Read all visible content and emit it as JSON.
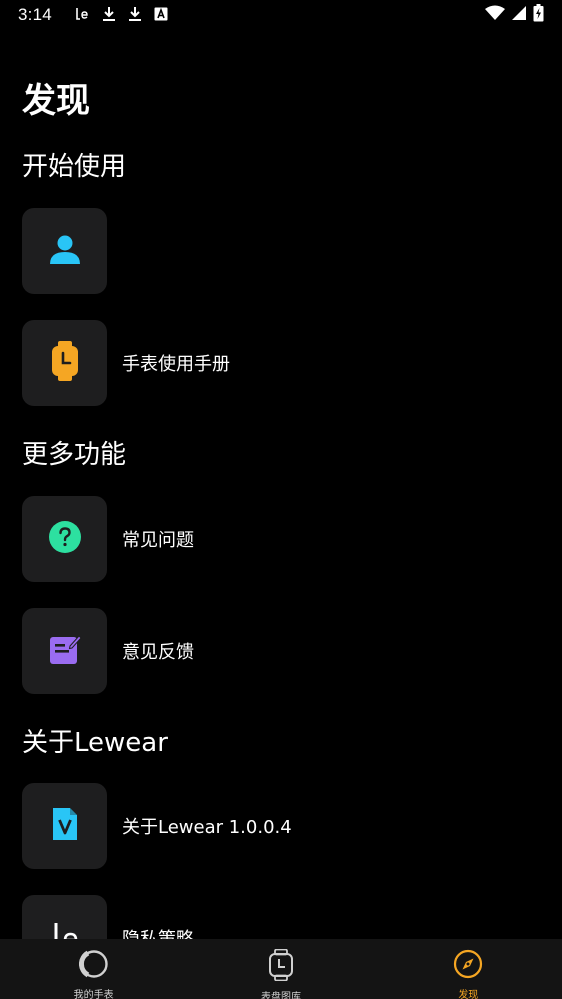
{
  "status_bar": {
    "time": "3:14",
    "left_icons": [
      "lewear-notification-icon",
      "download-icon",
      "download-icon",
      "font-a-icon"
    ],
    "right_icons": [
      "wifi-icon",
      "signal-icon",
      "battery-charging-icon"
    ]
  },
  "page": {
    "title": "发现"
  },
  "sections": [
    {
      "title": "开始使用",
      "items": [
        {
          "label": "",
          "icon": "user-icon",
          "icon_color": "#29c5f6"
        },
        {
          "label": "手表使用手册",
          "icon": "watch-icon",
          "icon_color": "#f5a623"
        }
      ]
    },
    {
      "title": "更多功能",
      "items": [
        {
          "label": "常见问题",
          "icon": "question-icon",
          "icon_color": "#2de0a0"
        },
        {
          "label": "意见反馈",
          "icon": "feedback-edit-icon",
          "icon_color": "#9a6cf0"
        }
      ]
    },
    {
      "title": "关于Lewear",
      "items": [
        {
          "label": "关于Lewear 1.0.0.4",
          "icon": "version-file-icon",
          "icon_color": "#29c5f6"
        },
        {
          "label": "隐私策略",
          "icon": "lewear-logo-icon",
          "icon_color": "#ffffff"
        }
      ]
    }
  ],
  "bottom_nav": [
    {
      "label": "我的手表",
      "icon": "watch-face-icon",
      "active": false
    },
    {
      "label": "表盘图库",
      "icon": "watch-icon",
      "active": false
    },
    {
      "label": "发现",
      "icon": "compass-icon",
      "active": true
    }
  ],
  "colors": {
    "background": "#000000",
    "tile": "#1e1e1f",
    "accent": "#f5a623",
    "nav_background": "#141414"
  }
}
